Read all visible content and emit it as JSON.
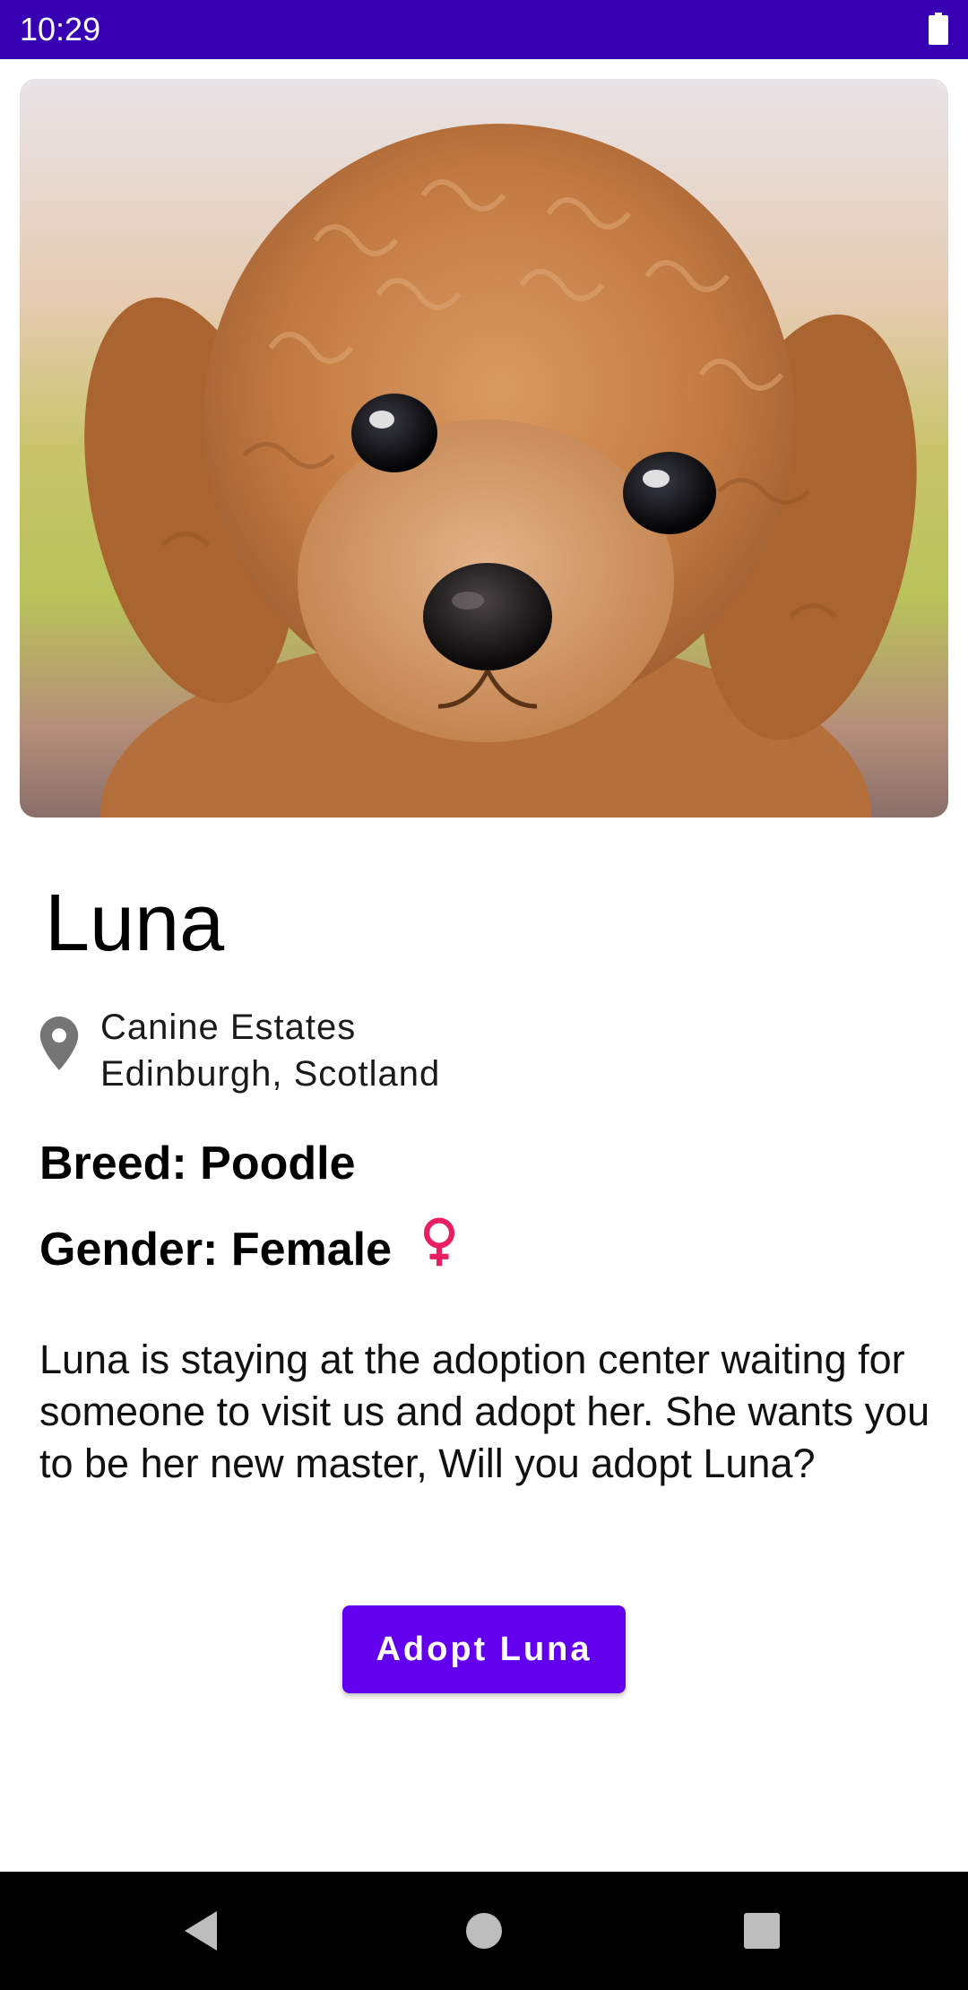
{
  "status_bar": {
    "time": "10:29",
    "battery_icon": "battery-full-icon"
  },
  "pet": {
    "photo_icon": "dog-photo",
    "name": "Luna",
    "location_icon": "location-pin-icon",
    "location_line1": "Canine Estates",
    "location_line2": "Edinburgh, Scotland",
    "breed_text": "Breed: Poodle",
    "gender_text": "Gender: Female",
    "gender_icon": "female-symbol-icon",
    "gender_icon_color": "#e91e63",
    "description": "Luna is staying at the adoption center waiting for someone to visit us and adopt her. She wants you to be her new master, Will you adopt Luna?"
  },
  "actions": {
    "adopt_label": "Adopt Luna"
  },
  "colors": {
    "status_bar": "#3700b3",
    "primary": "#6200ee",
    "nav_bar": "#000000"
  },
  "nav_bar": {
    "back_icon": "back-triangle-icon",
    "home_icon": "home-circle-icon",
    "recents_icon": "recents-square-icon"
  }
}
